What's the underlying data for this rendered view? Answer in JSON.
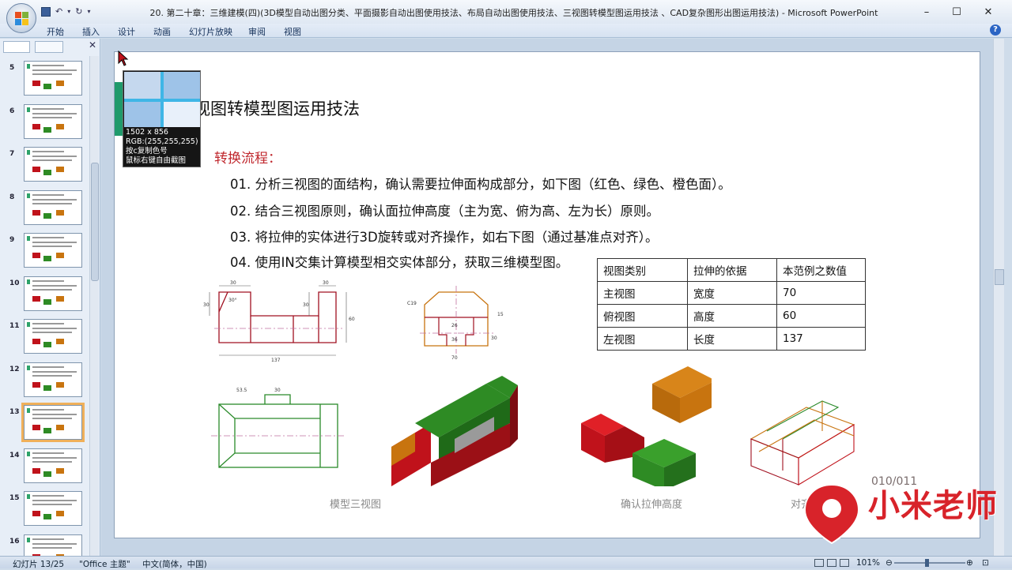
{
  "window": {
    "title": "20. 第二十章：三维建模(四)(3D模型自动出图分类、平面摄影自动出图使用技法、布局自动出图使用技法、三视图转模型图运用技法 、CAD复杂图形出图运用技法) - Microsoft PowerPoint",
    "controls": {
      "minimize": "–",
      "maximize": "☐",
      "close": "✕"
    }
  },
  "ribbon": {
    "tabs": [
      "开始",
      "插入",
      "设计",
      "动画",
      "幻灯片放映",
      "审阅",
      "视图"
    ],
    "help": "?"
  },
  "thumbnails": [
    {
      "num": "5",
      "selected": false
    },
    {
      "num": "6",
      "selected": false
    },
    {
      "num": "7",
      "selected": false
    },
    {
      "num": "8",
      "selected": false
    },
    {
      "num": "9",
      "selected": false
    },
    {
      "num": "10",
      "selected": false
    },
    {
      "num": "11",
      "selected": false
    },
    {
      "num": "12",
      "selected": false
    },
    {
      "num": "13",
      "selected": true
    },
    {
      "num": "14",
      "selected": false
    },
    {
      "num": "15",
      "selected": false
    },
    {
      "num": "16",
      "selected": false
    }
  ],
  "slide": {
    "title": "视图转模型图运用技法",
    "subhead": "转换流程：",
    "steps": [
      "01. 分析三视图的面结构，确认需要拉伸面构成部分，如下图（红色、绿色、橙色面）。",
      "02. 结合三视图原则，确认面拉伸高度（主为宽、俯为高、左为长）原则。",
      "03. 将拉伸的实体进行3D旋转或对齐操作，如右下图（通过基准点对齐）。",
      "04. 使用IN交集计算模型相交实体部分，获取三维模型图。"
    ],
    "table": {
      "header": [
        "视图类别",
        "拉伸的依据",
        "本范例之数值"
      ],
      "rows": [
        [
          "主视图",
          "宽度",
          "70"
        ],
        [
          "俯视图",
          "高度",
          "60"
        ],
        [
          "左视图",
          "长度",
          "137"
        ]
      ]
    },
    "captions": {
      "left": "模型三视图",
      "middle": "确认拉伸高度",
      "right": "对齐基准点"
    },
    "dims": {
      "front": [
        "30",
        "30",
        "30",
        "30°",
        "30",
        "60",
        "137"
      ],
      "side": [
        "C19",
        "26",
        "36",
        "15",
        "30",
        "70"
      ],
      "top": [
        "53.5",
        "30"
      ]
    }
  },
  "tooltip": {
    "size": "1502 x 856",
    "rgb": "RGB:(255,255,255)",
    "hint1": "按c复制色号",
    "hint2": "鼠标右键自由截图"
  },
  "watermark": {
    "brand": "小米老师",
    "counter": "010/011"
  },
  "status": {
    "slide": "幻灯片 13/25",
    "theme": "\"Office 主题\"",
    "lang": "中文(简体，中国)",
    "zoom": "101%"
  },
  "colors": {
    "red": "#c0121b",
    "green": "#2e8b24",
    "orange": "#c8740f",
    "gray": "#9a9a9a",
    "line_red": "#a01020",
    "line_green": "#2a8a2a"
  }
}
